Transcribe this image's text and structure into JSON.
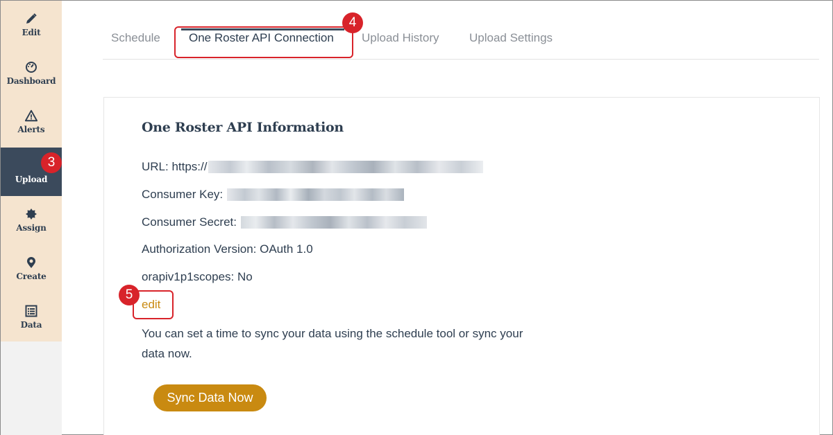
{
  "sidebar": {
    "items": [
      {
        "label": "Edit",
        "icon": "pencil-icon"
      },
      {
        "label": "Dashboard",
        "icon": "gauge-icon"
      },
      {
        "label": "Alerts",
        "icon": "warning-icon"
      },
      {
        "label": "Upload",
        "icon": "upload-icon",
        "active": true
      },
      {
        "label": "Assign",
        "icon": "badge-icon"
      },
      {
        "label": "Create",
        "icon": "map-pin-icon"
      },
      {
        "label": "Data",
        "icon": "list-icon"
      }
    ]
  },
  "tabs": [
    {
      "label": "Schedule"
    },
    {
      "label": "One Roster API Connection",
      "active": true
    },
    {
      "label": "Upload History"
    },
    {
      "label": "Upload Settings"
    }
  ],
  "card": {
    "title": "One Roster API Information",
    "url_label": "URL: https://",
    "consumer_key_label": "Consumer Key:",
    "consumer_secret_label": "Consumer Secret:",
    "auth_version": "Authorization Version: OAuth 1.0",
    "scopes": "orapiv1p1scopes: No",
    "edit_label": "edit",
    "description": "You can set a time to sync your data using the schedule tool or sync your data now.",
    "sync_button": "Sync Data Now"
  },
  "callouts": [
    "3",
    "4",
    "5"
  ],
  "colors": {
    "sidebar_bg": "#f5e4cf",
    "sidebar_active": "#3b4a5c",
    "accent": "#c98a11",
    "text": "#2e3e50",
    "callout": "#d8232a"
  }
}
